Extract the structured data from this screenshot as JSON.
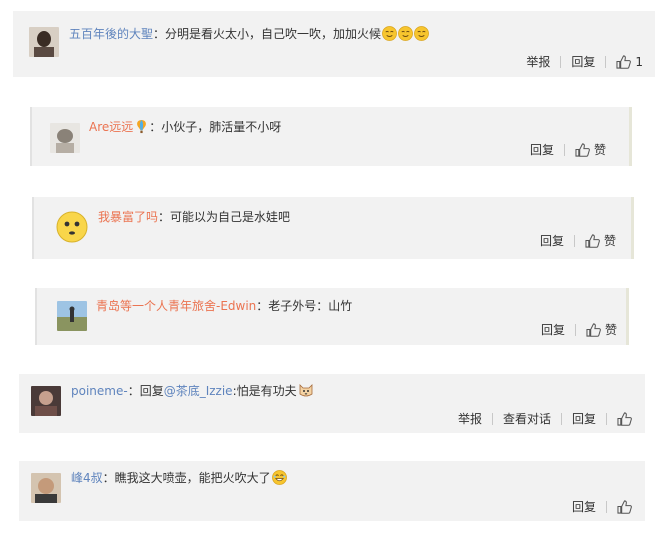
{
  "comments": [
    {
      "user": "五百年後的大聖",
      "text": "：分明是看火太小，自己吹一吹，加加火候",
      "actions": {
        "report": "举报",
        "reply": "回复",
        "like_count": "1"
      }
    },
    {
      "user": "Are远远",
      "text": "：小伙子，肺活量不小呀",
      "actions": {
        "reply": "回复",
        "like": "赞"
      }
    },
    {
      "user": "我暴富了吗",
      "text": "：可能以为自己是水娃吧",
      "actions": {
        "reply": "回复",
        "like": "赞"
      }
    },
    {
      "user": "青岛等一个人青年旅舍-Edwin",
      "text": "：老子外号：山竹",
      "actions": {
        "reply": "回复",
        "like": "赞"
      }
    },
    {
      "user": "poineme-",
      "text_prefix": "：回复",
      "mention": "@茶底_Izzie",
      "text": ":怕是有功夫",
      "actions": {
        "report": "举报",
        "view_conversation": "查看对话",
        "reply": "回复"
      }
    },
    {
      "user": "峰4叔",
      "text": "：瞧我这大喷壶，能把火吹大了",
      "actions": {
        "reply": "回复"
      }
    }
  ],
  "colors": {
    "card_bg": "#f2f2f2",
    "username_orange": "#eb7350",
    "username_blue": "#5f84bd"
  },
  "icons": [
    "thumbs-up-icon",
    "blush-emoji-icon",
    "balloon-icon",
    "cat-emoji-icon",
    "laugh-emoji-icon"
  ]
}
